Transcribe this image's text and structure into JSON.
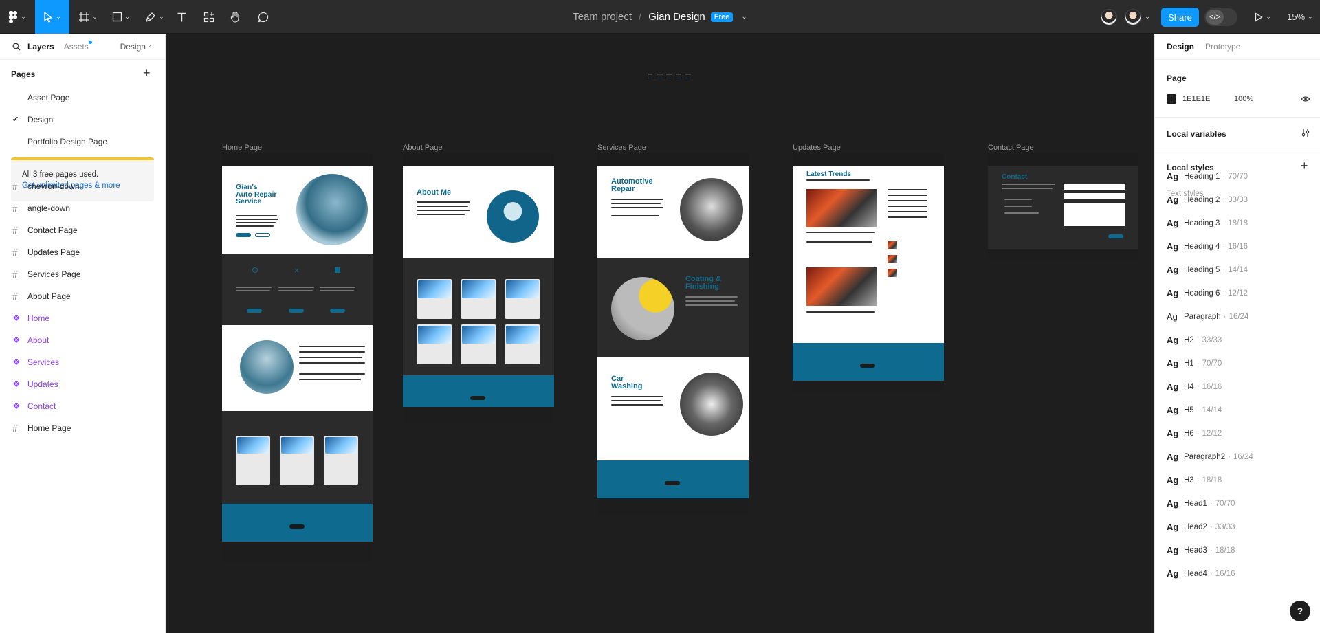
{
  "toolbar": {
    "project": "Team project",
    "separator": "/",
    "file_name": "Gian Design",
    "plan_badge": "Free",
    "share_label": "Share",
    "zoom": "15%"
  },
  "left_panel": {
    "tabs": {
      "layers": "Layers",
      "assets": "Assets",
      "design": "Design"
    },
    "pages_heading": "Pages",
    "pages": [
      {
        "label": "Asset Page",
        "selected": false
      },
      {
        "label": "Design",
        "selected": true
      },
      {
        "label": "Portfolio Design Page",
        "selected": false
      }
    ],
    "notice": {
      "text": "All 3 free pages used.",
      "link": "Get unlimited pages & more"
    },
    "layers": [
      {
        "label": "chevron-down",
        "type": "frame"
      },
      {
        "label": "angle-down",
        "type": "frame"
      },
      {
        "label": "Contact Page",
        "type": "frame"
      },
      {
        "label": "Updates Page",
        "type": "frame"
      },
      {
        "label": "Services Page",
        "type": "frame"
      },
      {
        "label": "About Page",
        "type": "frame"
      },
      {
        "label": "Home",
        "type": "component"
      },
      {
        "label": "About",
        "type": "component"
      },
      {
        "label": "Services",
        "type": "component"
      },
      {
        "label": "Updates",
        "type": "component"
      },
      {
        "label": "Contact",
        "type": "component"
      },
      {
        "label": "Home Page",
        "type": "frame"
      }
    ]
  },
  "canvas": {
    "frames": {
      "home": {
        "label": "Home Page",
        "hero_title": "Gian's\nAuto Repair\nService"
      },
      "about": {
        "label": "About Page",
        "hero_title": "About Me"
      },
      "services": {
        "label": "Services Page",
        "title_1": "Automotive\nRepair",
        "title_2": "Coating &\nFinishing",
        "title_3": "Car\nWashing"
      },
      "updates": {
        "label": "Updates Page",
        "hero_title": "Latest Trends"
      },
      "contact": {
        "label": "Contact Page",
        "hero_title": "Contact"
      }
    }
  },
  "right_panel": {
    "tabs": {
      "design": "Design",
      "prototype": "Prototype"
    },
    "page_heading": "Page",
    "page_color": "1E1E1E",
    "page_opacity": "100%",
    "local_variables": "Local variables",
    "local_styles": "Local styles",
    "text_styles_heading": "Text styles",
    "text_styles": [
      {
        "name": "Heading 1",
        "meta": "70/70"
      },
      {
        "name": "Heading 2",
        "meta": "33/33"
      },
      {
        "name": "Heading 3",
        "meta": "18/18"
      },
      {
        "name": "Heading 4",
        "meta": "16/16"
      },
      {
        "name": "Heading 5",
        "meta": "14/14"
      },
      {
        "name": "Heading 6",
        "meta": "12/12"
      },
      {
        "name": "Paragraph",
        "meta": "16/24"
      },
      {
        "name": "H2",
        "meta": "33/33"
      },
      {
        "name": "H1",
        "meta": "70/70"
      },
      {
        "name": "H4",
        "meta": "16/16"
      },
      {
        "name": "H5",
        "meta": "14/14"
      },
      {
        "name": "H6",
        "meta": "12/12"
      },
      {
        "name": "Paragraph2",
        "meta": "16/24"
      },
      {
        "name": "H3",
        "meta": "18/18"
      },
      {
        "name": "Head1",
        "meta": "70/70"
      },
      {
        "name": "Head2",
        "meta": "33/33"
      },
      {
        "name": "Head3",
        "meta": "18/18"
      },
      {
        "name": "Head4",
        "meta": "16/16"
      }
    ],
    "style_glyph": "Ag",
    "style_separator": "·"
  },
  "help": {
    "label": "?"
  }
}
